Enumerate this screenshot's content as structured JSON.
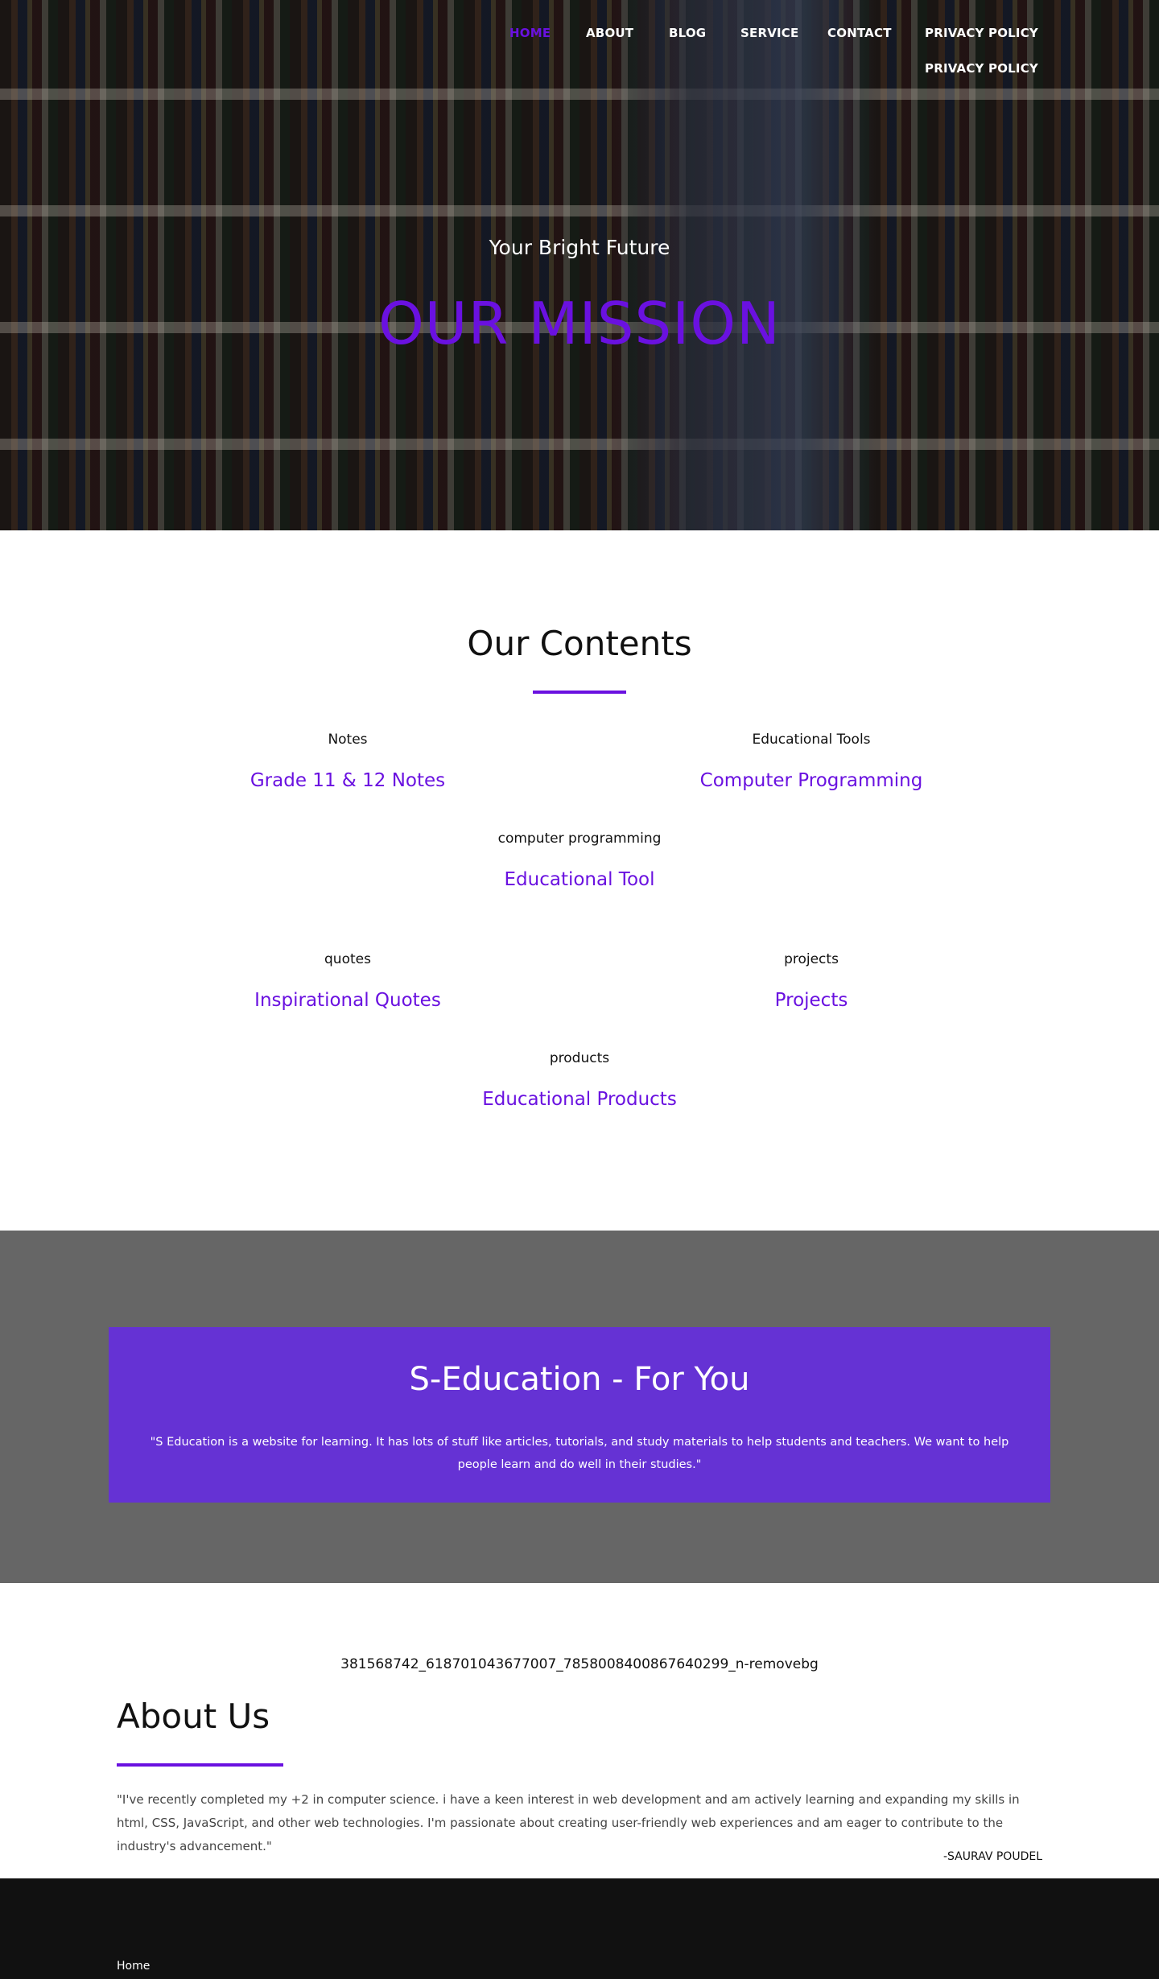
{
  "nav": {
    "items": [
      {
        "label": "HOME",
        "active": true
      },
      {
        "label": "ABOUT"
      },
      {
        "label": "BLOG"
      },
      {
        "label": "SERVICE"
      },
      {
        "label": "CONTACT"
      },
      {
        "label": "PRIVACY POLICY"
      },
      {
        "label": "PRIVACY POLICY"
      }
    ]
  },
  "hero": {
    "subtitle": "Your Bright Future",
    "title": "OUR MISSION"
  },
  "contents": {
    "title": "Our Contents",
    "cards": [
      {
        "img_alt": "Notes",
        "label": "Grade 11 & 12 Notes"
      },
      {
        "img_alt": "Educational Tools",
        "label": "Computer Programming"
      },
      {
        "img_alt": "computer programming",
        "label": "Educational Tool"
      },
      {
        "img_alt": "quotes",
        "label": "Inspirational Quotes"
      },
      {
        "img_alt": "projects",
        "label": "Projects"
      },
      {
        "img_alt": "products",
        "label": "Educational Products"
      }
    ]
  },
  "banner": {
    "title": "S-Education - For You",
    "quote": "\"S Education is a website for learning. It has lots of stuff like articles, tutorials, and study materials to help students and teachers. We want to help people learn and do well in their studies.\""
  },
  "about": {
    "img_alt": "381568742_618701043677007_7858008400867640299_n-removebg",
    "title": "About Us",
    "quote": "\"I've recently completed my +2 in computer science. i have a keen interest in web development and am actively learning and expanding my skills in html, CSS, JavaScript, and other web technologies. I'm passionate about creating user-friendly web experiences and am eager to contribute to the industry's advancement.\"",
    "signature": "-SAURAV POUDEL"
  },
  "footer": {
    "link": "Home"
  },
  "colors": {
    "accent": "#6a11e0",
    "banner": "#6532d4",
    "band": "#666666",
    "footer": "#111111"
  }
}
